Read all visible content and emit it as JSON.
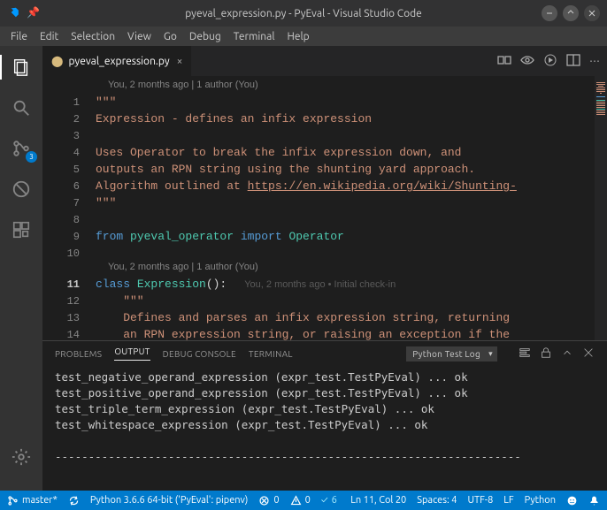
{
  "window": {
    "title": "pyeval_expression.py - PyEval - Visual Studio Code"
  },
  "menu": [
    "File",
    "Edit",
    "Selection",
    "View",
    "Go",
    "Debug",
    "Terminal",
    "Help"
  ],
  "activity": {
    "scm_badge": "3"
  },
  "tab": {
    "name": "pyeval_expression.py"
  },
  "codelens1": "You, 2 months ago | 1 author (You)",
  "codelens2": "You, 2 months ago | 1 author (You)",
  "inline_blame": "You, 2 months ago • Initial check-in",
  "code": {
    "l1": "\"\"\"",
    "l2": "Expression - defines an infix expression",
    "l3": "",
    "l4": "Uses Operator to break the infix expression down, and",
    "l5": "outputs an RPN string using the shunting yard approach.",
    "l6a": "Algorithm outlined at ",
    "l6b": "https://en.wikipedia.org/wiki/Shunting-",
    "l7": "\"\"\"",
    "l8": "",
    "l9_from": "from ",
    "l9_mod": "pyeval_operator ",
    "l9_import": "import ",
    "l9_cls": "Operator",
    "l11_class": "class ",
    "l11_name": "Expression",
    "l11_rest": "():",
    "l12": "    \"\"\"",
    "l13": "    Defines and parses an infix expression string, returning",
    "l14": "    an RPN expression string, or raising an exception if the"
  },
  "ln": {
    "l1": "1",
    "l2": "2",
    "l3": "3",
    "l4": "4",
    "l5": "5",
    "l6": "6",
    "l7": "7",
    "l8": "8",
    "l9": "9",
    "l10": "10",
    "l11": "11",
    "l12": "12",
    "l13": "13",
    "l14": "14"
  },
  "panel": {
    "tabs": {
      "problems": "PROBLEMS",
      "output": "OUTPUT",
      "debug": "DEBUG CONSOLE",
      "terminal": "TERMINAL"
    },
    "dropdown": "Python Test Log",
    "lines": [
      "test_negative_operand_expression (expr_test.TestPyEval) ... ok",
      "test_positive_operand_expression (expr_test.TestPyEval) ... ok",
      "test_triple_term_expression (expr_test.TestPyEval) ... ok",
      "test_whitespace_expression (expr_test.TestPyEval) ... ok"
    ],
    "dashes": "----------------------------------------------------------------------"
  },
  "status": {
    "branch": "master*",
    "sync": "",
    "python": "Python 3.6.6 64-bit ('PyEval': pipenv)",
    "errors": "0",
    "warnings": "0",
    "tests": "6",
    "line_col": "Ln 11, Col 20",
    "spaces": "Spaces: 4",
    "encoding": "UTF-8",
    "eol": "LF",
    "lang": "Python"
  }
}
